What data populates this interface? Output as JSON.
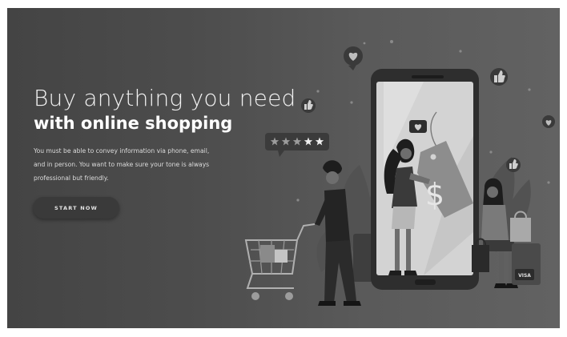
{
  "hero": {
    "headline_light": "Buy anything you need",
    "headline_bold": "with online shopping",
    "body_lines": [
      "You must be able to convey information via phone, email,",
      "and in person. You want to make sure your tone is always",
      "professional but friendly."
    ],
    "cta_label": "START NOW"
  },
  "illustration": {
    "rating_stars_filled": 3,
    "rating_stars_total": 5,
    "price_tag_symbol": "$",
    "card_label": "VISA"
  },
  "colors": {
    "background_dark": "#444444",
    "background_light": "#626262",
    "text_primary": "#ffffff",
    "text_secondary": "#dcdcdc"
  }
}
